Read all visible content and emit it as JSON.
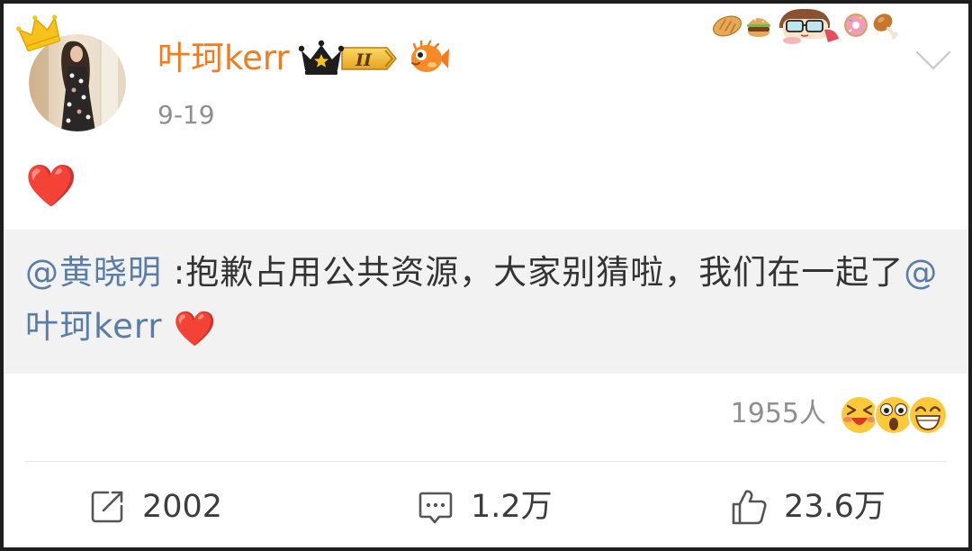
{
  "post": {
    "author": {
      "name": "叶珂kerr",
      "vip_level": "II",
      "date": "9-19"
    },
    "content": "❤️",
    "repost": {
      "mention": "@黄晓明",
      "text": " :抱歉占用公共资源，大家别猜啦，我们在一起了",
      "tail_mention": "@叶珂kerr",
      "tail_emoji": "❤️"
    },
    "reactions": {
      "count": "1955人"
    },
    "actions": {
      "repost_count": "2002",
      "comment_count": "1.2万",
      "like_count": "23.6万"
    }
  },
  "icons": {
    "avatar_badge": "crown-icon",
    "vip_badge": "vip-crown-badge-icon",
    "member_badge": "fish-icon",
    "card_decoration": [
      "bread-sticker",
      "burger-sticker",
      "cartoon-girl-sticker",
      "donut-sticker",
      "chicken-leg-sticker"
    ],
    "menu": "chevron-down-icon",
    "reactions": [
      "laughing-face-emoji",
      "shocked-face-emoji",
      "grinning-face-emoji"
    ],
    "repost": "share-icon",
    "comment": "comment-icon",
    "like": "thumbs-up-icon"
  },
  "colors": {
    "username": "#f07c22",
    "mention": "#5a7da8",
    "body_text": "#333333",
    "muted_text": "#8f8f8f",
    "count_text": "#3d3d3d",
    "repost_bg": "#f2f2f2",
    "heart": "#e3202b",
    "divider": "#e6e6e6",
    "frame": "#1e1e1e"
  }
}
